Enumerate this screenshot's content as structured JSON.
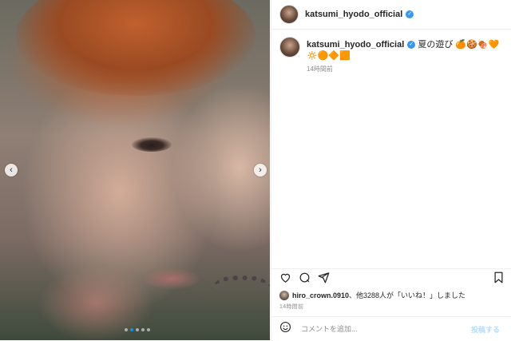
{
  "post": {
    "username": "katsumi_hyodo_official",
    "caption_text": "夏の遊び 🍊🍪🍖🧡🔅🟠🔶🟧",
    "caption_time": "14時間前",
    "likes_user": "hiro_crown.0910",
    "likes_rest": "、他3288人が「いいね！」しました",
    "post_time": "14時間前"
  },
  "carousel": {
    "prev_glyph": "‹",
    "next_glyph": "›",
    "dot_count": 5,
    "active_dot": 1
  },
  "comment": {
    "placeholder": "コメントを追加...",
    "post_label": "投稿する"
  },
  "colors": {
    "accent": "#0095f6",
    "verified": "#3897f0",
    "post_disabled": "#b2dffc"
  },
  "icons": [
    "chevron-left-icon",
    "chevron-right-icon",
    "verified-badge-icon",
    "heart-icon",
    "comment-icon",
    "share-icon",
    "bookmark-icon",
    "emoji-icon"
  ]
}
